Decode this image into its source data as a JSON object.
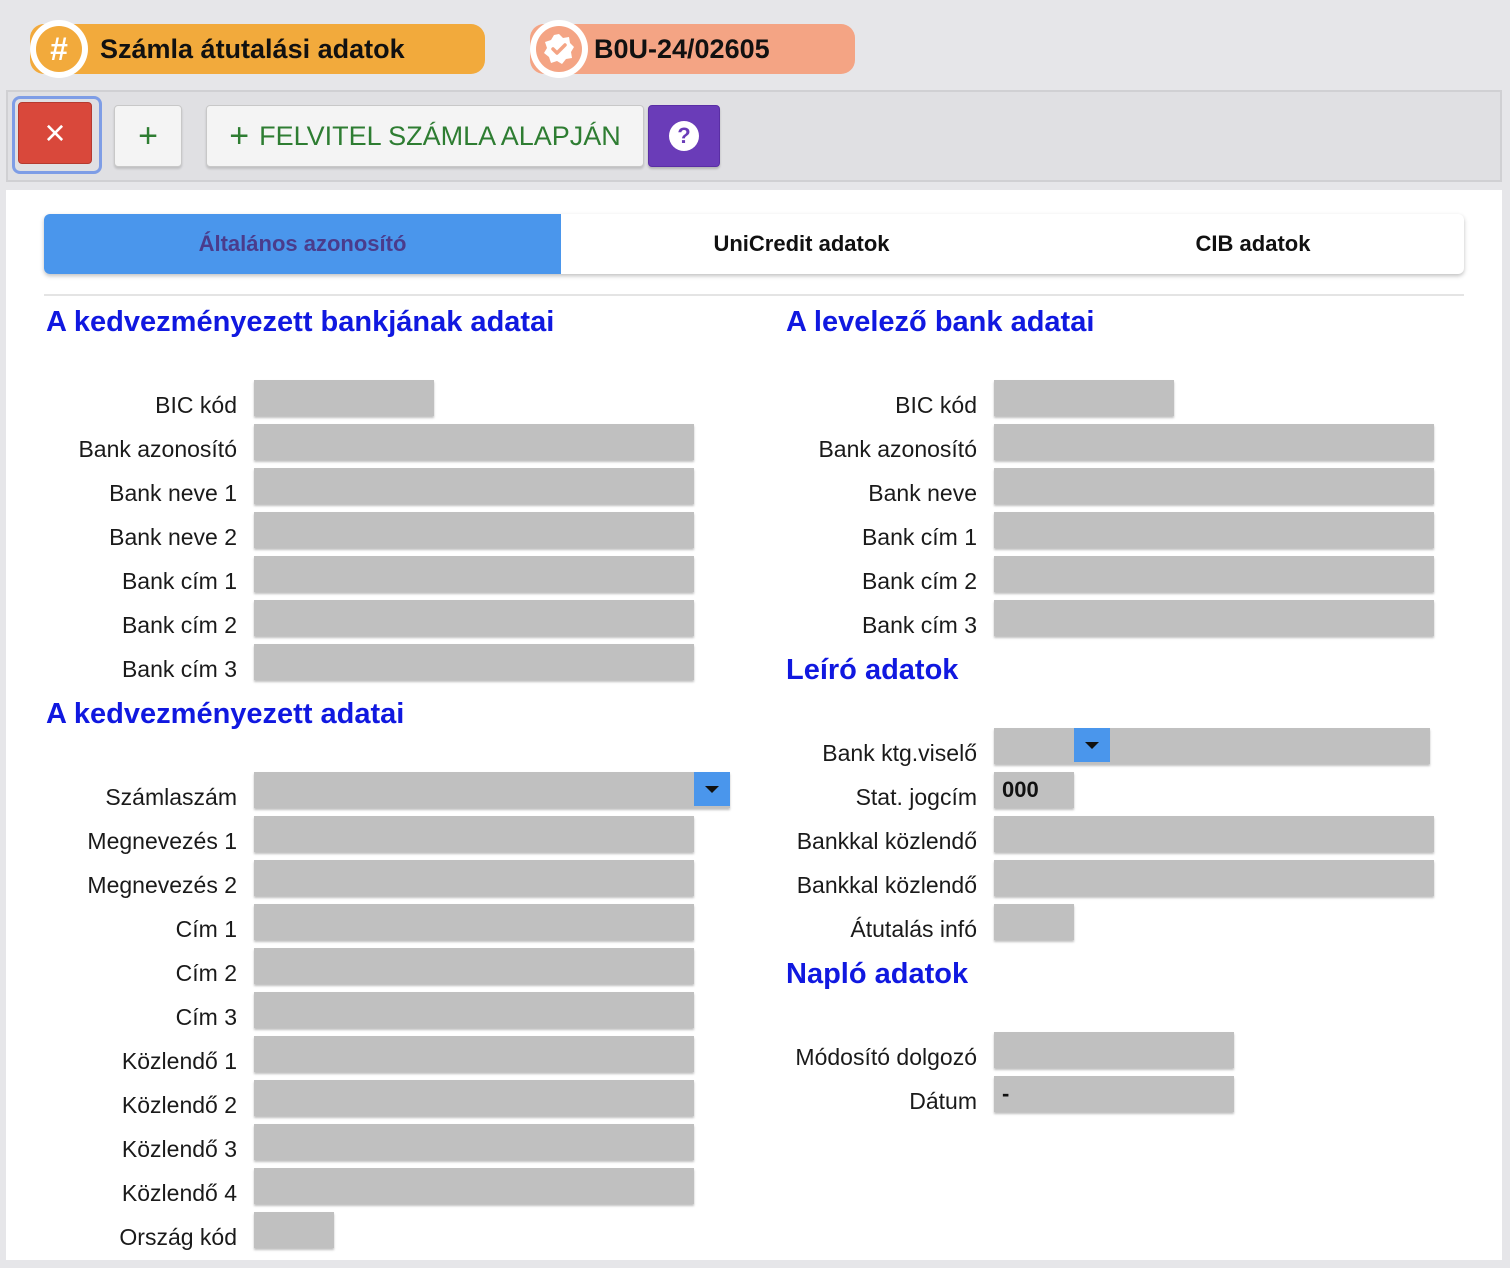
{
  "header": {
    "title_pill": {
      "icon": "hash-icon",
      "glyph": "#",
      "label": "Számla átutalási adatok"
    },
    "id_pill": {
      "icon": "verified-badge-icon",
      "label": "B0U-24/02605"
    }
  },
  "toolbar": {
    "close_glyph": "×",
    "add_glyph": "+",
    "felvitel_plus": "+",
    "felvitel_label": "FELVITEL SZÁMLA ALAPJÁN",
    "help_glyph": "?"
  },
  "tabs": [
    {
      "label": "Általános azonosító",
      "active": true
    },
    {
      "label": "UniCredit adatok",
      "active": false
    },
    {
      "label": "CIB adatok",
      "active": false
    }
  ],
  "left": {
    "bank_section": {
      "title": "A kedvezményezett bankjának adatai",
      "fields": [
        {
          "label": "BIC kód",
          "value": ""
        },
        {
          "label": "Bank azonosító",
          "value": ""
        },
        {
          "label": "Bank neve 1",
          "value": ""
        },
        {
          "label": "Bank neve 2",
          "value": ""
        },
        {
          "label": "Bank cím 1",
          "value": ""
        },
        {
          "label": "Bank cím 2",
          "value": ""
        },
        {
          "label": "Bank cím 3",
          "value": ""
        }
      ]
    },
    "beneficiary_section": {
      "title": "A kedvezményezett adatai",
      "fields": [
        {
          "label": "Számlaszám",
          "value": ""
        },
        {
          "label": "Megnevezés 1",
          "value": ""
        },
        {
          "label": "Megnevezés 2",
          "value": ""
        },
        {
          "label": "Cím 1",
          "value": ""
        },
        {
          "label": "Cím 2",
          "value": ""
        },
        {
          "label": "Cím 3",
          "value": ""
        },
        {
          "label": "Közlendő 1",
          "value": ""
        },
        {
          "label": "Közlendő 2",
          "value": ""
        },
        {
          "label": "Közlendő 3",
          "value": ""
        },
        {
          "label": "Közlendő 4",
          "value": ""
        },
        {
          "label": "Ország kód",
          "value": ""
        }
      ]
    }
  },
  "right": {
    "correspondent_section": {
      "title": "A levelező bank adatai",
      "fields": [
        {
          "label": "BIC kód",
          "value": ""
        },
        {
          "label": "Bank azonosító",
          "value": ""
        },
        {
          "label": "Bank neve",
          "value": ""
        },
        {
          "label": "Bank cím 1",
          "value": ""
        },
        {
          "label": "Bank cím 2",
          "value": ""
        },
        {
          "label": "Bank cím 3",
          "value": ""
        }
      ]
    },
    "descriptive_section": {
      "title": "Leíró adatok",
      "fields": [
        {
          "label": "Bank ktg.viselő",
          "value": ""
        },
        {
          "label": "Stat. jogcím",
          "value": "000"
        },
        {
          "label": "Bankkal közlendő",
          "value": ""
        },
        {
          "label": "Bankkal közlendő",
          "value": ""
        },
        {
          "label": "Átutalás infó",
          "value": ""
        }
      ]
    },
    "log_section": {
      "title": "Napló adatok",
      "fields": [
        {
          "label": "Módosító dolgozó",
          "value": ""
        },
        {
          "label": "Dátum",
          "value": "-"
        }
      ]
    }
  },
  "colors": {
    "accent_blue": "#4a96ec",
    "title_blue": "#1018e0",
    "close_red": "#d9483b",
    "help_purple": "#6a3cb8",
    "pill_orange": "#f2aa3c",
    "pill_salmon": "#f4a484",
    "action_green": "#2e7d32"
  }
}
